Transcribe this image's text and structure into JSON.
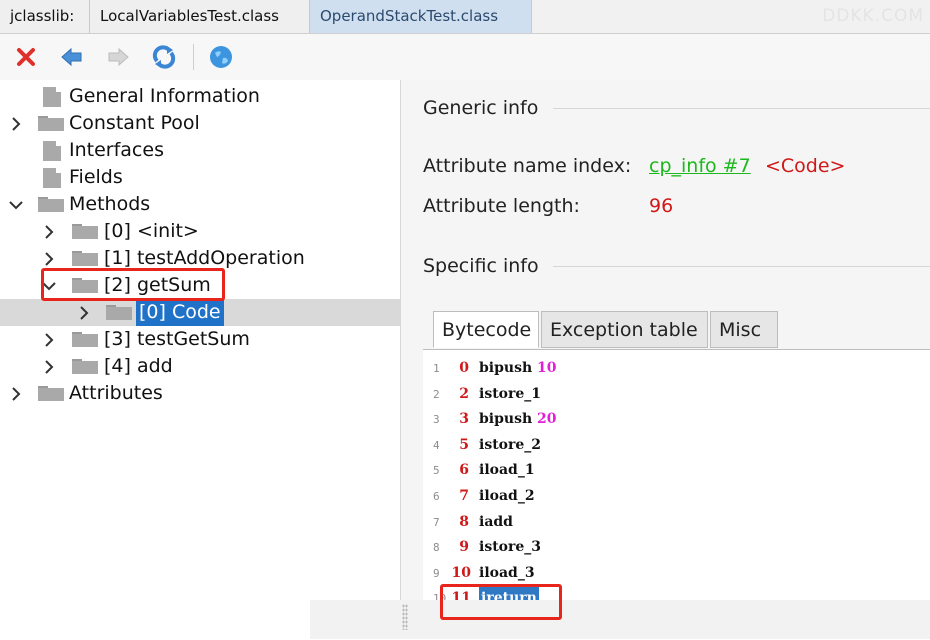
{
  "tabs": {
    "app_label": "jclasslib:",
    "items": [
      "LocalVariablesTest.class",
      "OperandStackTest.class"
    ],
    "active_index": 1
  },
  "watermark": "DDKK.COM",
  "toolbar": {
    "icons": [
      "close-icon",
      "back-icon",
      "forward-icon",
      "reload-icon",
      "web-icon"
    ]
  },
  "tree": {
    "general": "General Information",
    "constant_pool": "Constant Pool",
    "interfaces": "Interfaces",
    "fields": "Fields",
    "methods": "Methods",
    "method_items": [
      "[0] <init>",
      "[1] testAddOperation",
      "[2] getSum",
      "[3] testGetSum",
      "[4] add"
    ],
    "code_label": "[0] Code",
    "attributes": "Attributes"
  },
  "generic": {
    "title": "Generic info",
    "attr_name_label": "Attribute name index:",
    "attr_name_link": "cp_info #7",
    "attr_name_value": "<Code>",
    "attr_length_label": "Attribute length:",
    "attr_length_value": "96"
  },
  "specific": {
    "title": "Specific info",
    "tabs": [
      "Bytecode",
      "Exception table",
      "Misc"
    ],
    "active_tab": "Bytecode"
  },
  "bytecode": [
    {
      "line": "1",
      "offset": "0",
      "op": "bipush",
      "arg": "10"
    },
    {
      "line": "2",
      "offset": "2",
      "op": "istore_1",
      "arg": ""
    },
    {
      "line": "3",
      "offset": "3",
      "op": "bipush",
      "arg": "20"
    },
    {
      "line": "4",
      "offset": "5",
      "op": "istore_2",
      "arg": ""
    },
    {
      "line": "5",
      "offset": "6",
      "op": "iload_1",
      "arg": ""
    },
    {
      "line": "6",
      "offset": "7",
      "op": "iload_2",
      "arg": ""
    },
    {
      "line": "7",
      "offset": "8",
      "op": "iadd",
      "arg": ""
    },
    {
      "line": "8",
      "offset": "9",
      "op": "istore_3",
      "arg": ""
    },
    {
      "line": "9",
      "offset": "10",
      "op": "iload_3",
      "arg": ""
    },
    {
      "line": "10",
      "offset": "11",
      "op": "ireturn",
      "arg": ""
    }
  ],
  "colors": {
    "link": "#1cb81c",
    "value_red": "#d01818",
    "arg_magenta": "#e21fd6",
    "selection_blue": "#1f72c8",
    "annotation_red": "#e8251c"
  }
}
